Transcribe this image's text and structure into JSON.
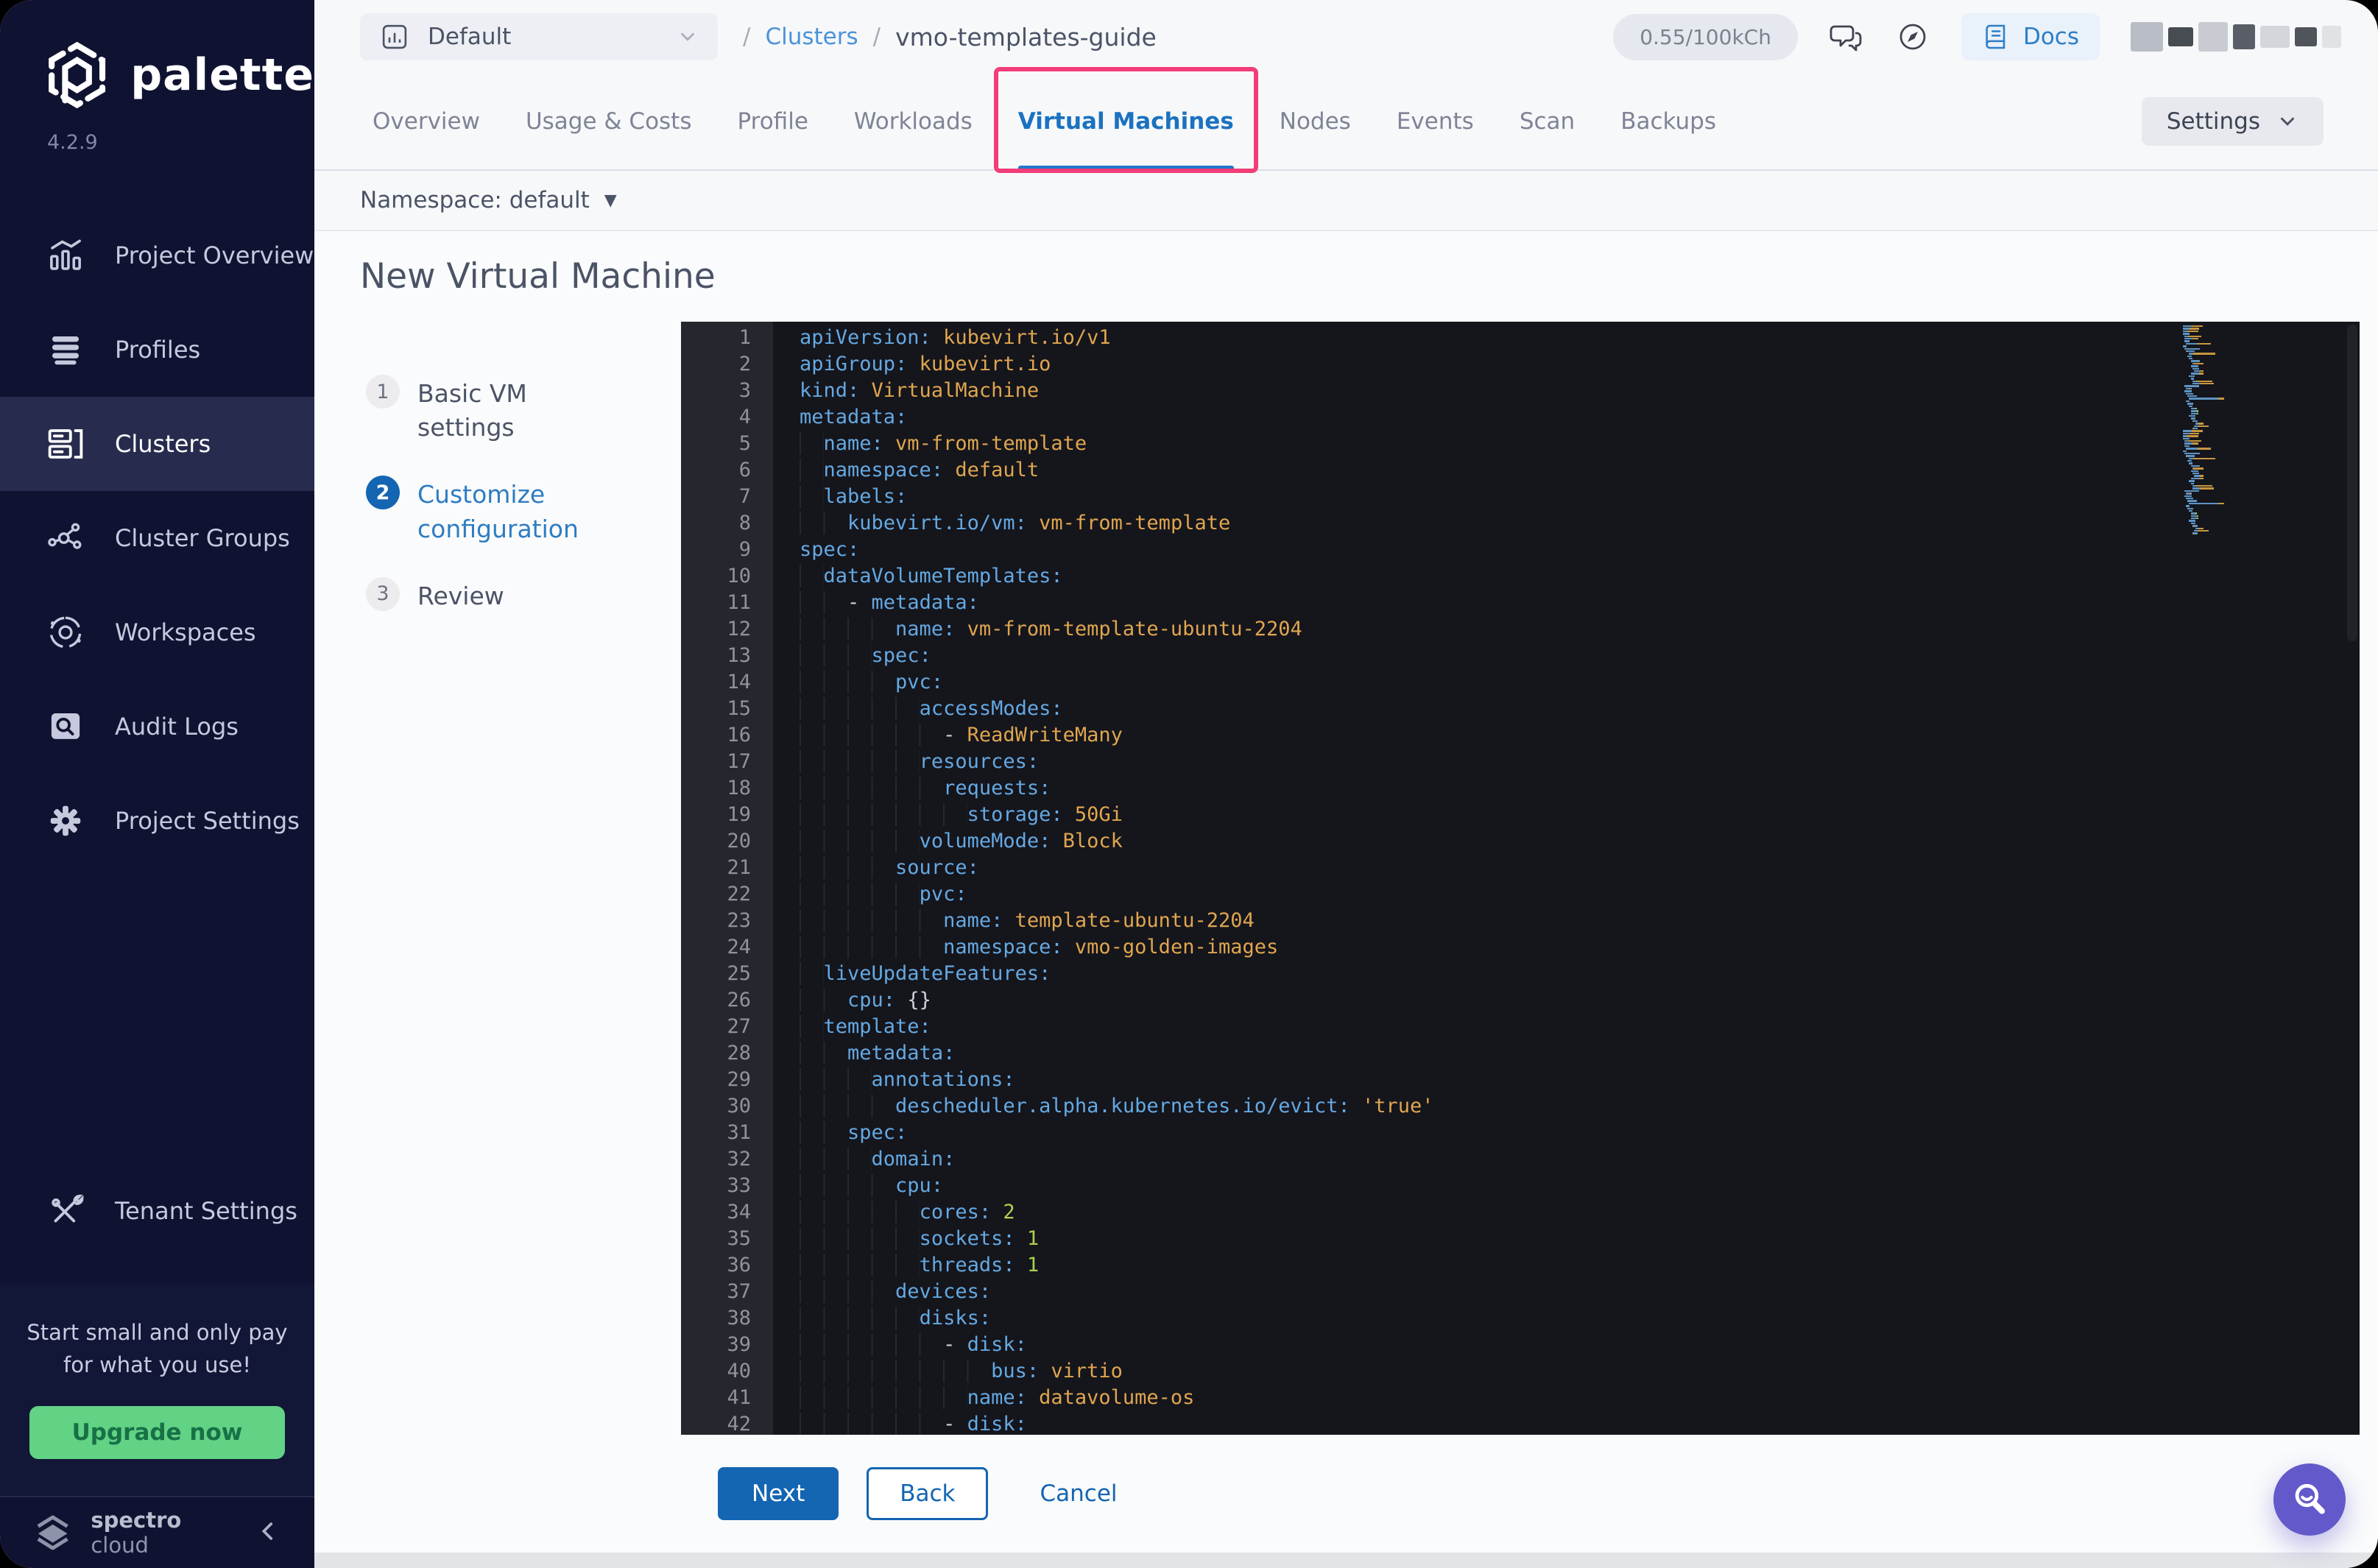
{
  "sidebar": {
    "logo_text": "palette",
    "version": "4.2.9",
    "items": [
      {
        "label": "Project Overview",
        "icon": "bar-chart-icon",
        "active": false
      },
      {
        "label": "Profiles",
        "icon": "layers-icon",
        "active": false
      },
      {
        "label": "Clusters",
        "icon": "server-icon",
        "active": true
      },
      {
        "label": "Cluster Groups",
        "icon": "network-icon",
        "active": false
      },
      {
        "label": "Workspaces",
        "icon": "orbit-icon",
        "active": false
      },
      {
        "label": "Audit Logs",
        "icon": "audit-doc-icon",
        "active": false
      },
      {
        "label": "Project Settings",
        "icon": "gear-icon",
        "active": false
      }
    ],
    "tenant_settings": {
      "label": "Tenant Settings",
      "icon": "tools-icon"
    },
    "promo": {
      "message": "Start small and only pay for what you use!",
      "button_label": "Upgrade now"
    },
    "footer": {
      "brand_bold": "spectro",
      "brand_light": "cloud"
    }
  },
  "topbar": {
    "project_selector": {
      "label": "Default"
    },
    "breadcrumb": {
      "separator": "/",
      "link": "Clusters",
      "current": "vmo-templates-guide"
    },
    "usage_badge": "0.55/100kCh",
    "docs_button": "Docs"
  },
  "tabs": {
    "items": [
      "Overview",
      "Usage & Costs",
      "Profile",
      "Workloads",
      "Virtual Machines",
      "Nodes",
      "Events",
      "Scan",
      "Backups"
    ],
    "active": "Virtual Machines",
    "settings_button": "Settings"
  },
  "namespace_bar": {
    "label": "Namespace: default"
  },
  "page": {
    "title": "New Virtual Machine"
  },
  "wizard": {
    "steps": [
      {
        "number": "1",
        "label": "Basic VM settings",
        "active": false
      },
      {
        "number": "2",
        "label": "Customize configuration",
        "active": true
      },
      {
        "number": "3",
        "label": "Review",
        "active": false
      }
    ]
  },
  "actions": {
    "next": "Next",
    "back": "Back",
    "cancel": "Cancel"
  },
  "editor": {
    "language": "yaml",
    "lines": [
      [
        [
          "apiVersion:",
          "k"
        ],
        [
          " kubevirt.io/v1",
          "v"
        ]
      ],
      [
        [
          "apiGroup:",
          "k"
        ],
        [
          " kubevirt.io",
          "v"
        ]
      ],
      [
        [
          "kind:",
          "k"
        ],
        [
          " VirtualMachine",
          "v"
        ]
      ],
      [
        [
          "metadata:",
          "k"
        ]
      ],
      [
        [
          "  name:",
          "k"
        ],
        [
          " vm-from-template",
          "v"
        ]
      ],
      [
        [
          "  namespace:",
          "k"
        ],
        [
          " default",
          "v"
        ]
      ],
      [
        [
          "  labels:",
          "k"
        ]
      ],
      [
        [
          "    kubevirt.io/vm:",
          "k"
        ],
        [
          " vm-from-template",
          "v"
        ]
      ],
      [
        [
          "spec:",
          "k"
        ]
      ],
      [
        [
          "  dataVolumeTemplates:",
          "k"
        ]
      ],
      [
        [
          "    - ",
          "p"
        ],
        [
          "metadata:",
          "k"
        ]
      ],
      [
        [
          "        name:",
          "k"
        ],
        [
          " vm-from-template-ubuntu-2204",
          "v"
        ]
      ],
      [
        [
          "      spec:",
          "k"
        ]
      ],
      [
        [
          "        pvc:",
          "k"
        ]
      ],
      [
        [
          "          accessModes:",
          "k"
        ]
      ],
      [
        [
          "            - ",
          "p"
        ],
        [
          "ReadWriteMany",
          "v"
        ]
      ],
      [
        [
          "          resources:",
          "k"
        ]
      ],
      [
        [
          "            requests:",
          "k"
        ]
      ],
      [
        [
          "              storage:",
          "k"
        ],
        [
          " 50Gi",
          "v"
        ]
      ],
      [
        [
          "          volumeMode:",
          "k"
        ],
        [
          " Block",
          "v"
        ]
      ],
      [
        [
          "        source:",
          "k"
        ]
      ],
      [
        [
          "          pvc:",
          "k"
        ]
      ],
      [
        [
          "            name:",
          "k"
        ],
        [
          " template-ubuntu-2204",
          "v"
        ]
      ],
      [
        [
          "            namespace:",
          "k"
        ],
        [
          " vmo-golden-images",
          "v"
        ]
      ],
      [
        [
          "  liveUpdateFeatures:",
          "k"
        ]
      ],
      [
        [
          "    cpu:",
          "k"
        ],
        [
          " {}",
          "p"
        ]
      ],
      [
        [
          "  template:",
          "k"
        ]
      ],
      [
        [
          "    metadata:",
          "k"
        ]
      ],
      [
        [
          "      annotations:",
          "k"
        ]
      ],
      [
        [
          "        descheduler.alpha.kubernetes.io/evict:",
          "k"
        ],
        [
          " 'true'",
          "v"
        ]
      ],
      [
        [
          "    spec:",
          "k"
        ]
      ],
      [
        [
          "      domain:",
          "k"
        ]
      ],
      [
        [
          "        cpu:",
          "k"
        ]
      ],
      [
        [
          "          cores:",
          "k"
        ],
        [
          " 2",
          "n"
        ]
      ],
      [
        [
          "          sockets:",
          "k"
        ],
        [
          " 1",
          "n"
        ]
      ],
      [
        [
          "          threads:",
          "k"
        ],
        [
          " 1",
          "n"
        ]
      ],
      [
        [
          "        devices:",
          "k"
        ]
      ],
      [
        [
          "          disks:",
          "k"
        ]
      ],
      [
        [
          "            - ",
          "p"
        ],
        [
          "disk:",
          "k"
        ]
      ],
      [
        [
          "                bus:",
          "k"
        ],
        [
          " virtio",
          "v"
        ]
      ],
      [
        [
          "              name:",
          "k"
        ],
        [
          " datavolume-os",
          "v"
        ]
      ],
      [
        [
          "            - ",
          "p"
        ],
        [
          "disk:",
          "k"
        ]
      ]
    ]
  },
  "colors": {
    "accent_blue": "#1465b2",
    "link_blue": "#2e7cc2",
    "annotation_pink": "#f23d78",
    "upgrade_green": "#62d285",
    "sidebar_bg": "#0f1331",
    "editor_bg": "#15151c",
    "yaml_key": "#64a9e2",
    "yaml_value": "#dfa64f",
    "yaml_number": "#abd14f"
  }
}
